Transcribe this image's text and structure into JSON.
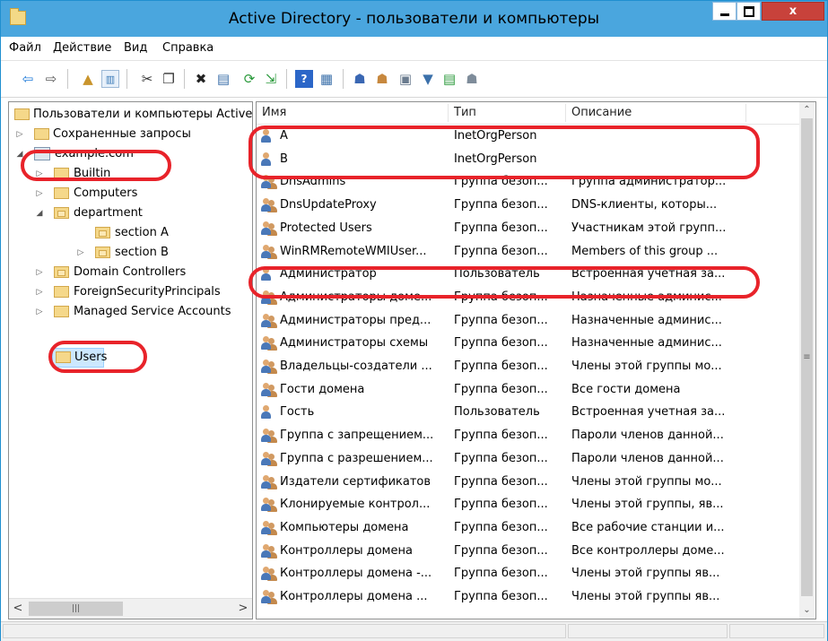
{
  "window": {
    "title": "Active Directory - пользователи и компьютеры"
  },
  "menu": [
    "Файл",
    "Действие",
    "Вид",
    "Справка"
  ],
  "tree": {
    "root": "Пользователи и компьютеры Active Directory",
    "saved_queries": "Сохраненные запросы",
    "domain": "example.com",
    "builtin": "Builtin",
    "computers": "Computers",
    "department": "department",
    "section_a": "section A",
    "section_b": "section B",
    "domain_controllers": "Domain Controllers",
    "foreign": "ForeignSecurityPrincipals",
    "managed": "Managed Service Accounts",
    "users": "Users"
  },
  "list": {
    "columns": [
      "Имя",
      "Тип",
      "Описание"
    ],
    "rows": [
      {
        "name": "A",
        "type": "InetOrgPerson",
        "desc": "",
        "icon": "user-icon"
      },
      {
        "name": "B",
        "type": "InetOrgPerson",
        "desc": "",
        "icon": "user-icon"
      },
      {
        "name": "DnsAdmins",
        "type": "Группа безоп...",
        "desc": "Группа администратор...",
        "icon": "group-icon"
      },
      {
        "name": "DnsUpdateProxy",
        "type": "Группа безоп...",
        "desc": "DNS-клиенты, которы...",
        "icon": "group-icon"
      },
      {
        "name": "Protected Users",
        "type": "Группа безоп...",
        "desc": "Участникам этой групп...",
        "icon": "group-icon"
      },
      {
        "name": "WinRMRemoteWMIUser...",
        "type": "Группа безоп...",
        "desc": "Members of this group ...",
        "icon": "group-icon"
      },
      {
        "name": "Администратор",
        "type": "Пользователь",
        "desc": "Встроенная учетная за...",
        "icon": "user-icon"
      },
      {
        "name": "Администраторы доме...",
        "type": "Группа безоп...",
        "desc": "Назначенные админис...",
        "icon": "group-icon"
      },
      {
        "name": "Администраторы пред...",
        "type": "Группа безоп...",
        "desc": "Назначенные админис...",
        "icon": "group-icon"
      },
      {
        "name": "Администраторы схемы",
        "type": "Группа безоп...",
        "desc": "Назначенные админис...",
        "icon": "group-icon"
      },
      {
        "name": "Владельцы-создатели ...",
        "type": "Группа безоп...",
        "desc": "Члены этой группы мо...",
        "icon": "group-icon"
      },
      {
        "name": "Гости домена",
        "type": "Группа безоп...",
        "desc": "Все гости домена",
        "icon": "group-icon"
      },
      {
        "name": "Гость",
        "type": "Пользователь",
        "desc": "Встроенная учетная за...",
        "icon": "user-icon"
      },
      {
        "name": "Группа с запрещением...",
        "type": "Группа безоп...",
        "desc": "Пароли членов данной...",
        "icon": "group-icon"
      },
      {
        "name": "Группа с разрешением...",
        "type": "Группа безоп...",
        "desc": "Пароли членов данной...",
        "icon": "group-icon"
      },
      {
        "name": "Издатели сертификатов",
        "type": "Группа безоп...",
        "desc": "Члены этой группы мо...",
        "icon": "group-icon"
      },
      {
        "name": "Клонируемые контрол...",
        "type": "Группа безоп...",
        "desc": "Члены этой группы, яв...",
        "icon": "group-icon"
      },
      {
        "name": "Компьютеры домена",
        "type": "Группа безоп...",
        "desc": "Все рабочие станции и...",
        "icon": "group-icon"
      },
      {
        "name": "Контроллеры домена",
        "type": "Группа безоп...",
        "desc": "Все контроллеры доме...",
        "icon": "group-icon"
      },
      {
        "name": "Контроллеры домена -...",
        "type": "Группа безоп...",
        "desc": "Члены этой группы яв...",
        "icon": "group-icon"
      },
      {
        "name": "Контроллеры домена ...",
        "type": "Группа безоп...",
        "desc": "Члены этой группы яв...",
        "icon": "group-icon"
      }
    ]
  },
  "colors": {
    "titlebar": "#4aa6de",
    "highlight": "#e8232a",
    "selection": "#cce8ff"
  }
}
